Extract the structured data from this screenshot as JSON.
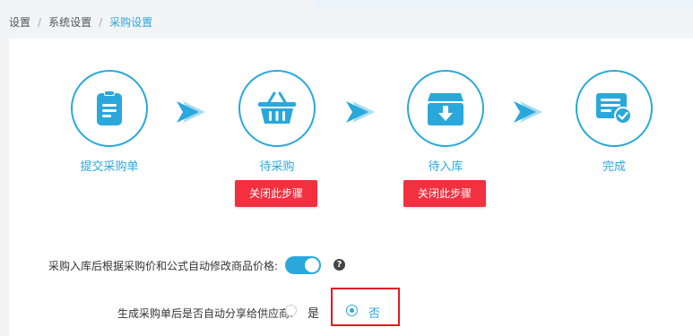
{
  "breadcrumb": {
    "items": [
      "设置",
      "系统设置",
      "采购设置"
    ],
    "separator": "/"
  },
  "steps": [
    {
      "label": "提交采购单",
      "icon": "document-icon"
    },
    {
      "label": "待采购",
      "icon": "basket-icon"
    },
    {
      "label": "待入库",
      "icon": "inbox-download-icon"
    },
    {
      "label": "完成",
      "icon": "completed-card-icon"
    }
  ],
  "buttons": {
    "close_step": "关闭此步骤"
  },
  "settings": {
    "auto_price_label": "采购入库后根据采购价和公式自动修改商品价格:",
    "auto_price_enabled": true,
    "auto_share_label": "生成采购单后是否自动分享给供应商:",
    "auto_share_options": [
      "是",
      "否"
    ],
    "auto_share_selected": "否"
  },
  "colors": {
    "accent": "#2aa8dc",
    "danger": "#f23040",
    "highlight": "#e01b24"
  }
}
